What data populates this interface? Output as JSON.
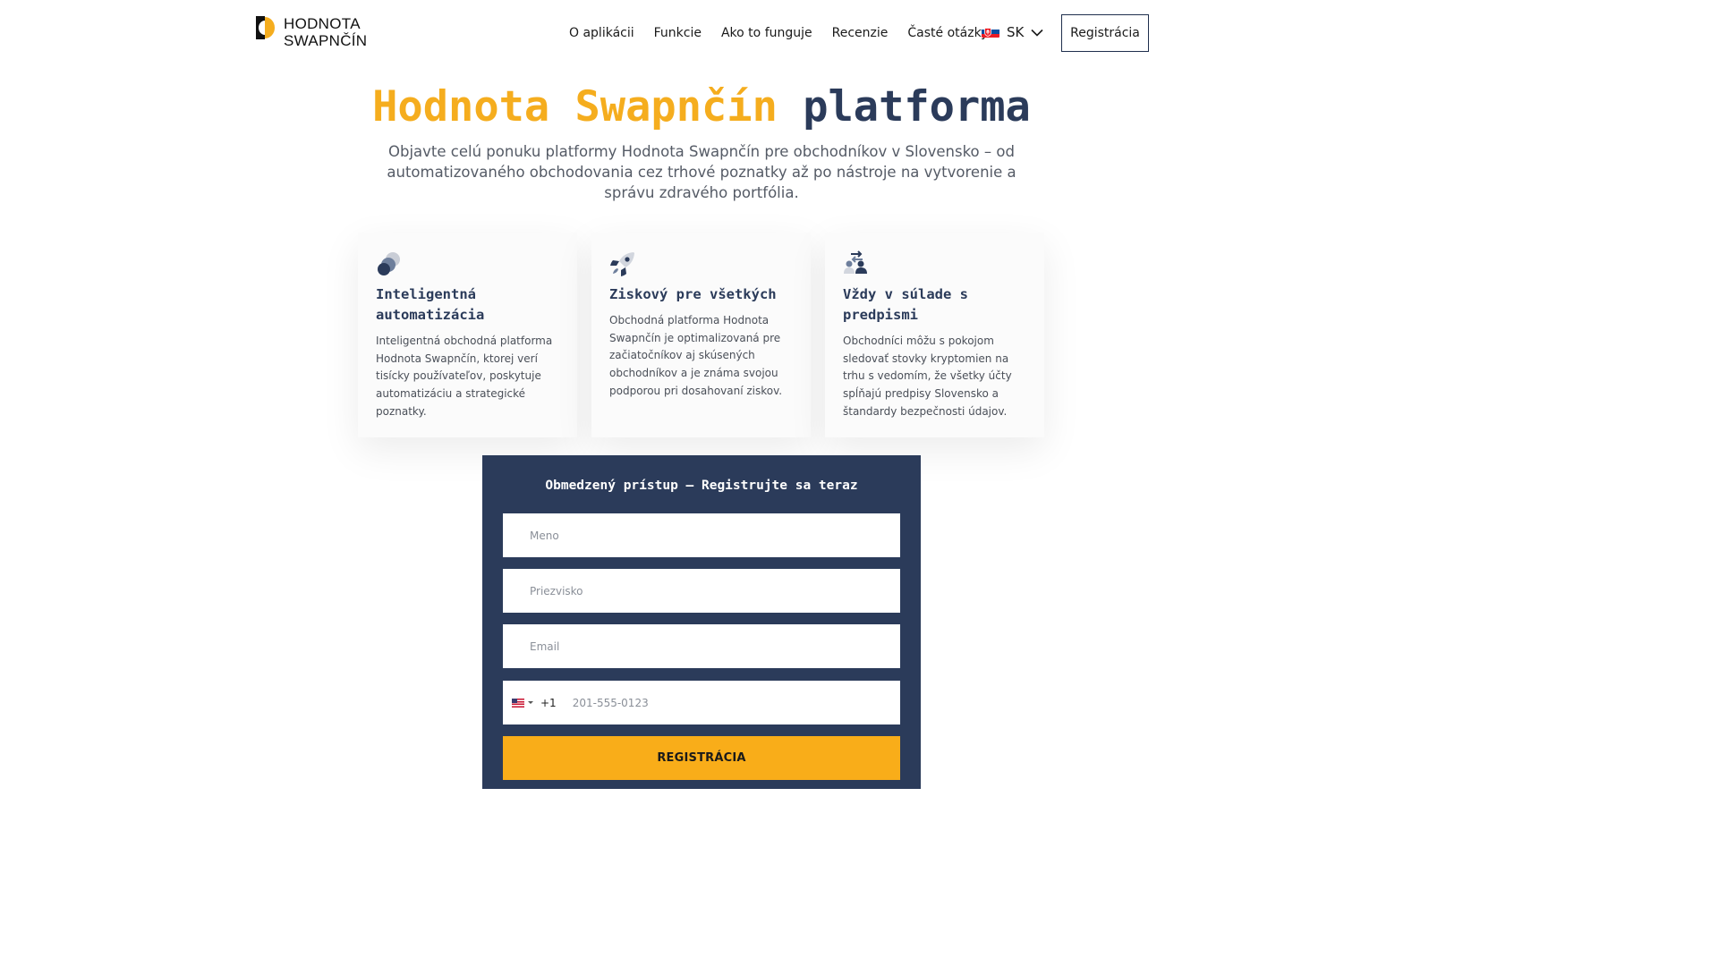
{
  "header": {
    "logo_line1": "HODNOTA",
    "logo_line2": "SWAPNČÍN",
    "nav": [
      "O aplikácii",
      "Funkcie",
      "Ako to funguje",
      "Recenzie",
      "Časté otázky"
    ],
    "language": "SK",
    "register_label": "Registrácia"
  },
  "hero": {
    "title_accent": "Hodnota Swapnčín",
    "title_rest": "platforma",
    "subtitle": "Objavte celú ponuku platformy Hodnota Swapnčín pre obchodníkov v Slovensko – od automatizovaného obchodovania cez trhové poznatky až po nástroje na vytvorenie a správu zdravého portfólia."
  },
  "cards": [
    {
      "icon": "automation-circles-icon",
      "title": "Inteligentná automatizácia",
      "text": "Inteligentná obchodná platforma Hodnota Swapnčín, ktorej verí tisícky používateľov, poskytuje automatizáciu a strategické poznatky."
    },
    {
      "icon": "rocket-icon",
      "title": "Ziskový pre všetkých",
      "text": "Obchodná platforma Hodnota Swapnčín je optimalizovaná pre začiatočníkov aj skúsených obchodníkov a je známa svojou podporou pri dosahovaní ziskov."
    },
    {
      "icon": "users-exchange-icon",
      "title": "Vždy v súlade s predpismi",
      "text": "Obchodníci môžu s pokojom sledovať stovky kryptomien na trhu s vedomím, že všetky účty spĺňajú predpisy Slovensko a štandardy bezpečnosti údajov."
    }
  ],
  "form": {
    "title": "Obmedzený prístup – Registrujte sa teraz",
    "first_name_placeholder": "Meno",
    "last_name_placeholder": "Priezvisko",
    "email_placeholder": "Email",
    "dial_code": "+1",
    "phone_placeholder": "201-555-0123",
    "submit_label": "REGISTRÁCIA"
  },
  "colors": {
    "accent": "#f5ad1e",
    "navy": "#2b3b5a",
    "button": "#f9ad19"
  }
}
